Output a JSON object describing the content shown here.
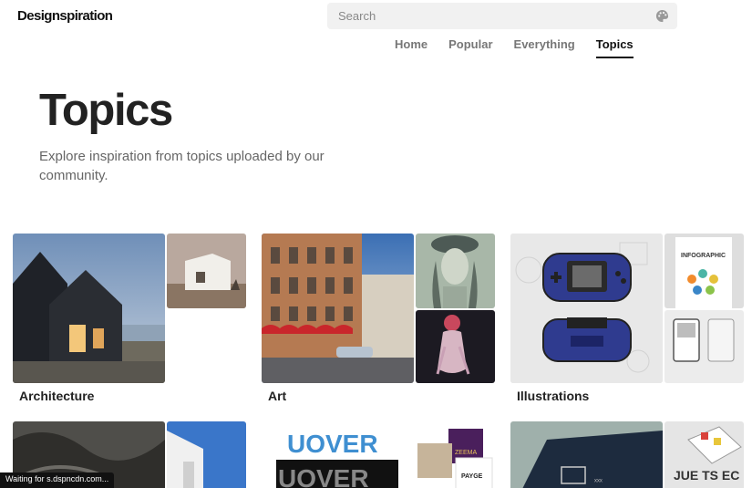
{
  "header": {
    "logo": "Designspiration",
    "search_placeholder": "Search",
    "palette_icon": "palette-icon"
  },
  "nav": {
    "items": [
      {
        "label": "Home",
        "active": false
      },
      {
        "label": "Popular",
        "active": false
      },
      {
        "label": "Everything",
        "active": false
      },
      {
        "label": "Topics",
        "active": true
      }
    ]
  },
  "page": {
    "title": "Topics",
    "description": "Explore inspiration from topics uploaded by our community."
  },
  "topics": [
    {
      "label": "Architecture"
    },
    {
      "label": "Art"
    },
    {
      "label": "Illustrations"
    },
    {
      "label": ""
    },
    {
      "label": "",
      "image_text": {
        "upper": "UOVER",
        "lower": "UOVER",
        "badge1": "ZEEMA",
        "badge2": "PAYGE"
      }
    },
    {
      "label": "",
      "image_text": {
        "book": "ₓₓₓ",
        "letters": "JUE TS EC"
      }
    }
  ],
  "status": "Waiting for s.dspncdn.com..."
}
